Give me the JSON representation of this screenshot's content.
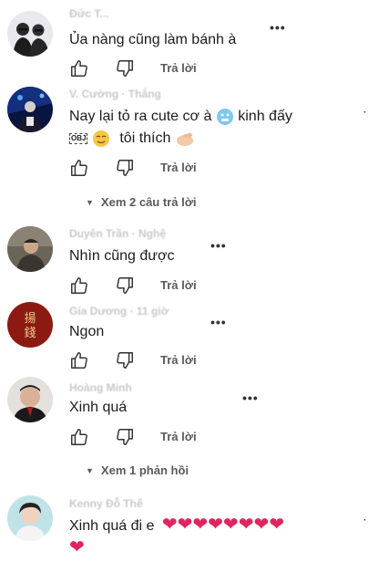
{
  "comments": [
    {
      "name": "Đức T...",
      "text": "Ủa nàng cũng làm bánh à",
      "reply_label": "Trả lời"
    },
    {
      "name": "V. Cường · Thắng",
      "text_part1": "Nay lại tỏ ra cute cơ à",
      "text_part2": "kinh đấy",
      "text_obj": "OBJ",
      "text_part3": "tôi thích",
      "reply_label": "Trả lời",
      "view_replies": "Xem 2 câu trả lời"
    },
    {
      "name": "Duyên Trần · Nghệ",
      "text": "Nhìn cũng được",
      "reply_label": "Trả lời"
    },
    {
      "name": "Gia Dương · 11 giờ",
      "text": "Ngon",
      "reply_label": "Trả lời"
    },
    {
      "name": "Hoàng Minh",
      "text": "Xinh quá",
      "reply_label": "Trả lời",
      "view_replies": "Xem 1 phản hồi"
    },
    {
      "name": "Kenny Đỗ Thế",
      "text": "Xinh quá đi e"
    }
  ],
  "colors": {
    "heart": "#e0245e",
    "reply": "#5a5a5a"
  },
  "icons": {
    "like": "thumbs-up-icon",
    "dislike": "thumbs-down-icon",
    "more": "more-dots-icon"
  }
}
